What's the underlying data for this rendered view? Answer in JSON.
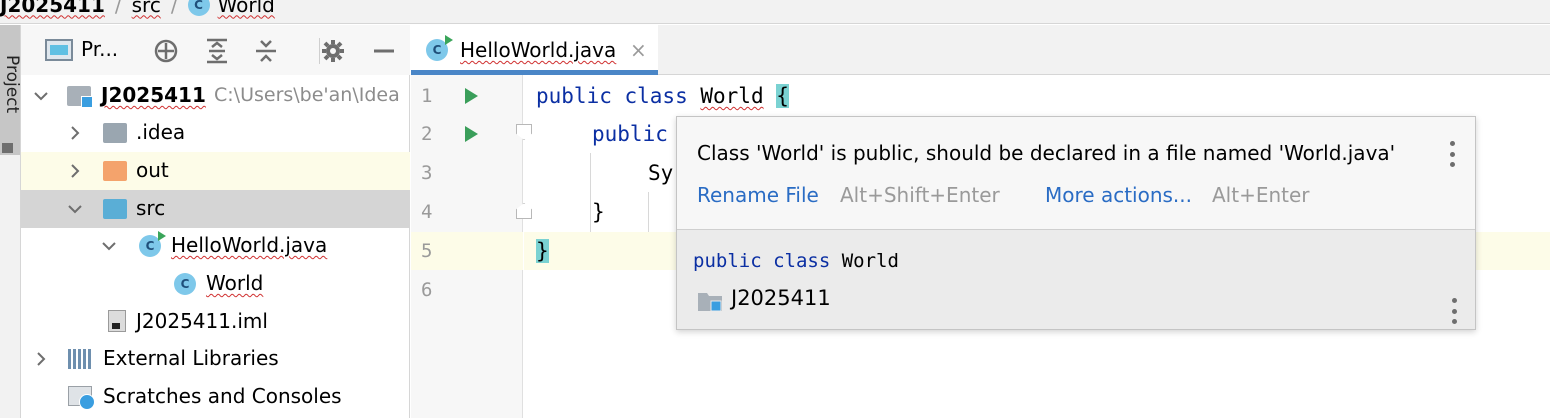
{
  "breadcrumb": {
    "project": "J2025411",
    "folder": "src",
    "class": "World"
  },
  "tool_stripe": {
    "project_label": "Project"
  },
  "project_panel": {
    "title": "Pr...",
    "toolbar_icons": [
      "target-icon",
      "expand-all-icon",
      "collapse-all-icon",
      "gear-icon",
      "minimize-icon"
    ],
    "tree": {
      "root": {
        "name": "J2025411",
        "path": "C:\\Users\\be'an\\Idea"
      },
      "idea": ".idea",
      "out": "out",
      "src": "src",
      "hello_file": "HelloWorld.java",
      "world_class": "World",
      "iml": "J2025411.iml",
      "libraries": "External Libraries",
      "scratches": "Scratches and Consoles"
    }
  },
  "editor": {
    "tab_label": "HelloWorld.java",
    "tab_close": "×",
    "line_numbers": [
      "1",
      "2",
      "3",
      "4",
      "5",
      "6"
    ],
    "code": {
      "l1_kw": "public class ",
      "l1_name": "World",
      "l1_brace": "{",
      "l2": "public",
      "l3": "Sy",
      "l4": "}",
      "l5": "}"
    }
  },
  "popup": {
    "message": "Class 'World' is public, should be declared in a file named 'World.java'",
    "action1": "Rename File",
    "action1_shortcut": "Alt+Shift+Enter",
    "action2": "More actions...",
    "action2_shortcut": "Alt+Enter",
    "code_kw": "public class ",
    "code_name": "World",
    "module": "J2025411"
  },
  "colors": {
    "keyword": "#0b2fa3",
    "link": "#2a6cc4",
    "brace_highlight": "#7ad2d2",
    "run_green": "#3a9e5a",
    "tab_underline": "#4a86c7"
  }
}
